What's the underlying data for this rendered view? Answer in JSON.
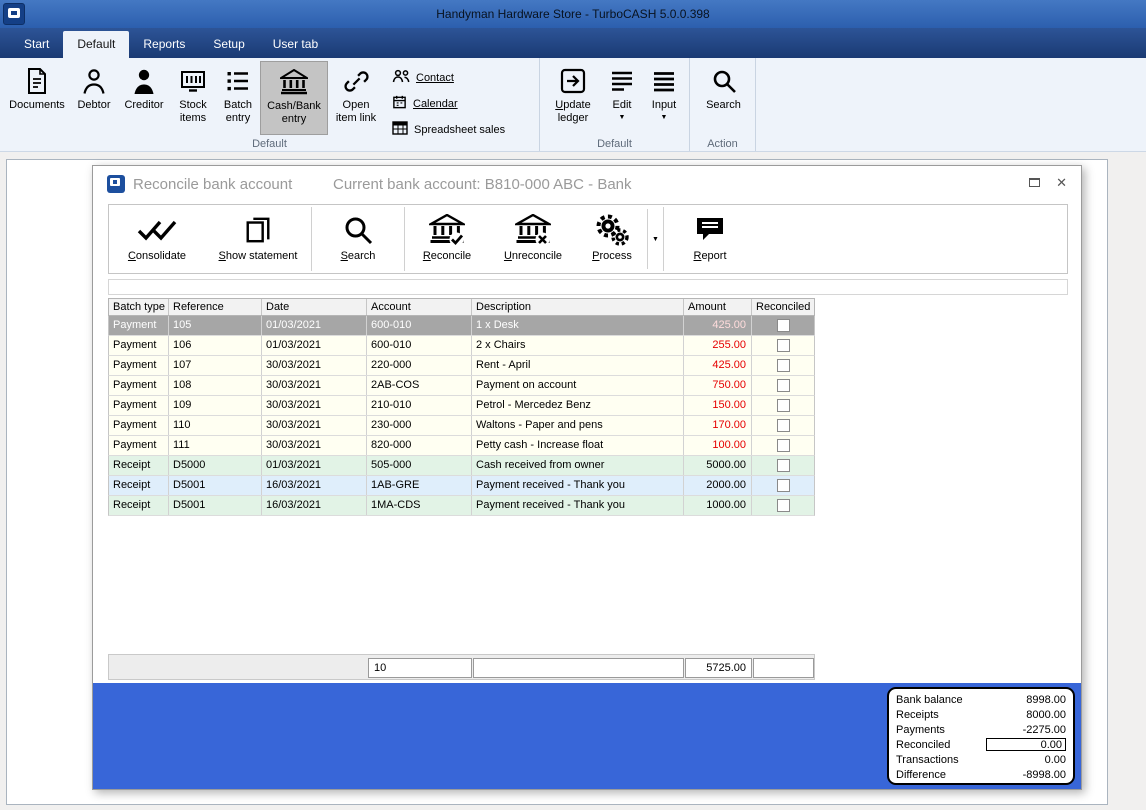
{
  "window": {
    "title": "Handyman Hardware Store - TurboCASH 5.0.0.398"
  },
  "tabs": {
    "items": [
      {
        "label": "Start"
      },
      {
        "label": "Default"
      },
      {
        "label": "Reports"
      },
      {
        "label": "Setup"
      },
      {
        "label": "User tab"
      }
    ],
    "active": "Default"
  },
  "ribbon": {
    "documents": "Documents",
    "debtor": "Debtor",
    "creditor": "Creditor",
    "stock_items": "Stock\nitems",
    "batch_entry": "Batch\nentry",
    "cash_bank_entry": "Cash/Bank\nentry",
    "open_item_link": "Open\nitem link",
    "contact": "Contact",
    "calendar": "Calendar",
    "spreadsheet_sales": "Spreadsheet sales",
    "update_ledger": "Update\nledger",
    "edit": "Edit",
    "input": "Input",
    "search": "Search",
    "group1": "Default",
    "group2": "Default",
    "group3": "Action"
  },
  "dialog": {
    "title": "Reconcile bank account",
    "subtitle": "Current bank account: B810-000 ABC - Bank",
    "toolbar": {
      "consolidate": "Consolidate",
      "show_statement": "Show statement",
      "search": "Search",
      "reconcile": "Reconcile",
      "unreconcile": "Unreconcile",
      "process": "Process",
      "report": "Report"
    },
    "table": {
      "headers": [
        "Batch type",
        "Reference",
        "Date",
        "Account",
        "Description",
        "Amount",
        "Reconciled"
      ],
      "selected_row_index": 0,
      "rows": [
        {
          "kind": "payment",
          "cells": [
            "Payment",
            "105",
            "01/03/2021",
            "600-010",
            "1 x Desk",
            "425.00"
          ]
        },
        {
          "kind": "payment",
          "cells": [
            "Payment",
            "106",
            "01/03/2021",
            "600-010",
            "2 x Chairs",
            "255.00"
          ]
        },
        {
          "kind": "payment",
          "cells": [
            "Payment",
            "107",
            "30/03/2021",
            "220-000",
            "Rent - April",
            "425.00"
          ]
        },
        {
          "kind": "payment",
          "cells": [
            "Payment",
            "108",
            "30/03/2021",
            "2AB-COS",
            "Payment on account",
            "750.00"
          ]
        },
        {
          "kind": "payment",
          "cells": [
            "Payment",
            "109",
            "30/03/2021",
            "210-010",
            "Petrol - Mercedez Benz",
            "150.00"
          ]
        },
        {
          "kind": "payment",
          "cells": [
            "Payment",
            "110",
            "30/03/2021",
            "230-000",
            "Waltons - Paper and pens",
            "170.00"
          ]
        },
        {
          "kind": "payment",
          "cells": [
            "Payment",
            "111",
            "30/03/2021",
            "820-000",
            "Petty cash - Increase float",
            "100.00"
          ]
        },
        {
          "kind": "receipt",
          "cells": [
            "Receipt",
            "D5000",
            "01/03/2021",
            "505-000",
            "Cash received from owner",
            "5000.00"
          ]
        },
        {
          "kind": "receipt",
          "cells": [
            "Receipt",
            "D5001",
            "16/03/2021",
            "1AB-GRE",
            "Payment received - Thank you",
            "2000.00"
          ]
        },
        {
          "kind": "receipt",
          "cells": [
            "Receipt",
            "D5001",
            "16/03/2021",
            "1MA-CDS",
            "Payment received - Thank you",
            "1000.00"
          ]
        }
      ]
    },
    "footer": {
      "field1": "10",
      "field2": "",
      "field3": "5725.00",
      "field4": ""
    },
    "summary": {
      "rows": [
        {
          "label": "Bank balance",
          "value": "8998.00"
        },
        {
          "label": "Receipts",
          "value": "8000.00"
        },
        {
          "label": "Payments",
          "value": "-2275.00"
        },
        {
          "label": "Reconciled",
          "value": "0.00"
        },
        {
          "label": "Transactions",
          "value": "0.00"
        },
        {
          "label": "Difference",
          "value": "-8998.00"
        }
      ]
    }
  },
  "icons": [
    "turbocash-logo",
    "document",
    "person-outline",
    "person-filled",
    "stock-box",
    "batch-list",
    "bank",
    "link",
    "contacts",
    "calendar",
    "spreadsheet-grid",
    "update-ledger-arrow",
    "edit-lines",
    "input-lines",
    "search-magnifier",
    "double-check",
    "copy-pages",
    "bank-check",
    "bank-cross",
    "gears",
    "chevron-down",
    "report-bubble",
    "checkbox-unchecked",
    "restore-box",
    "close-x"
  ],
  "colors": {
    "titlebar_blue": "#2f62b4",
    "tabstrip_navy": "#1e4080",
    "panel_blue": "#3866d8",
    "negative_amount_red": "#e60000",
    "payment_row": "#fffff2",
    "receipt_row_green": "#e2f3e6",
    "receipt_row_blue": "#dfeefb",
    "selected_row_gray": "#a6a6a6"
  }
}
